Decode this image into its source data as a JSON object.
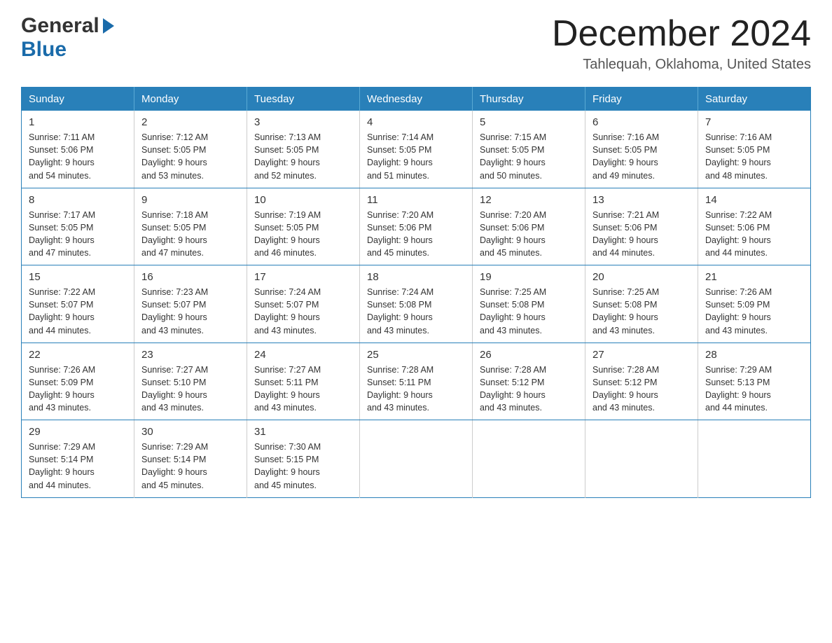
{
  "logo": {
    "general": "General",
    "blue": "Blue",
    "arrow": "▶"
  },
  "header": {
    "month_title": "December 2024",
    "location": "Tahlequah, Oklahoma, United States"
  },
  "weekdays": [
    "Sunday",
    "Monday",
    "Tuesday",
    "Wednesday",
    "Thursday",
    "Friday",
    "Saturday"
  ],
  "weeks": [
    [
      {
        "day": "1",
        "sunrise": "7:11 AM",
        "sunset": "5:06 PM",
        "daylight": "9 hours and 54 minutes."
      },
      {
        "day": "2",
        "sunrise": "7:12 AM",
        "sunset": "5:05 PM",
        "daylight": "9 hours and 53 minutes."
      },
      {
        "day": "3",
        "sunrise": "7:13 AM",
        "sunset": "5:05 PM",
        "daylight": "9 hours and 52 minutes."
      },
      {
        "day": "4",
        "sunrise": "7:14 AM",
        "sunset": "5:05 PM",
        "daylight": "9 hours and 51 minutes."
      },
      {
        "day": "5",
        "sunrise": "7:15 AM",
        "sunset": "5:05 PM",
        "daylight": "9 hours and 50 minutes."
      },
      {
        "day": "6",
        "sunrise": "7:16 AM",
        "sunset": "5:05 PM",
        "daylight": "9 hours and 49 minutes."
      },
      {
        "day": "7",
        "sunrise": "7:16 AM",
        "sunset": "5:05 PM",
        "daylight": "9 hours and 48 minutes."
      }
    ],
    [
      {
        "day": "8",
        "sunrise": "7:17 AM",
        "sunset": "5:05 PM",
        "daylight": "9 hours and 47 minutes."
      },
      {
        "day": "9",
        "sunrise": "7:18 AM",
        "sunset": "5:05 PM",
        "daylight": "9 hours and 47 minutes."
      },
      {
        "day": "10",
        "sunrise": "7:19 AM",
        "sunset": "5:05 PM",
        "daylight": "9 hours and 46 minutes."
      },
      {
        "day": "11",
        "sunrise": "7:20 AM",
        "sunset": "5:06 PM",
        "daylight": "9 hours and 45 minutes."
      },
      {
        "day": "12",
        "sunrise": "7:20 AM",
        "sunset": "5:06 PM",
        "daylight": "9 hours and 45 minutes."
      },
      {
        "day": "13",
        "sunrise": "7:21 AM",
        "sunset": "5:06 PM",
        "daylight": "9 hours and 44 minutes."
      },
      {
        "day": "14",
        "sunrise": "7:22 AM",
        "sunset": "5:06 PM",
        "daylight": "9 hours and 44 minutes."
      }
    ],
    [
      {
        "day": "15",
        "sunrise": "7:22 AM",
        "sunset": "5:07 PM",
        "daylight": "9 hours and 44 minutes."
      },
      {
        "day": "16",
        "sunrise": "7:23 AM",
        "sunset": "5:07 PM",
        "daylight": "9 hours and 43 minutes."
      },
      {
        "day": "17",
        "sunrise": "7:24 AM",
        "sunset": "5:07 PM",
        "daylight": "9 hours and 43 minutes."
      },
      {
        "day": "18",
        "sunrise": "7:24 AM",
        "sunset": "5:08 PM",
        "daylight": "9 hours and 43 minutes."
      },
      {
        "day": "19",
        "sunrise": "7:25 AM",
        "sunset": "5:08 PM",
        "daylight": "9 hours and 43 minutes."
      },
      {
        "day": "20",
        "sunrise": "7:25 AM",
        "sunset": "5:08 PM",
        "daylight": "9 hours and 43 minutes."
      },
      {
        "day": "21",
        "sunrise": "7:26 AM",
        "sunset": "5:09 PM",
        "daylight": "9 hours and 43 minutes."
      }
    ],
    [
      {
        "day": "22",
        "sunrise": "7:26 AM",
        "sunset": "5:09 PM",
        "daylight": "9 hours and 43 minutes."
      },
      {
        "day": "23",
        "sunrise": "7:27 AM",
        "sunset": "5:10 PM",
        "daylight": "9 hours and 43 minutes."
      },
      {
        "day": "24",
        "sunrise": "7:27 AM",
        "sunset": "5:11 PM",
        "daylight": "9 hours and 43 minutes."
      },
      {
        "day": "25",
        "sunrise": "7:28 AM",
        "sunset": "5:11 PM",
        "daylight": "9 hours and 43 minutes."
      },
      {
        "day": "26",
        "sunrise": "7:28 AM",
        "sunset": "5:12 PM",
        "daylight": "9 hours and 43 minutes."
      },
      {
        "day": "27",
        "sunrise": "7:28 AM",
        "sunset": "5:12 PM",
        "daylight": "9 hours and 43 minutes."
      },
      {
        "day": "28",
        "sunrise": "7:29 AM",
        "sunset": "5:13 PM",
        "daylight": "9 hours and 44 minutes."
      }
    ],
    [
      {
        "day": "29",
        "sunrise": "7:29 AM",
        "sunset": "5:14 PM",
        "daylight": "9 hours and 44 minutes."
      },
      {
        "day": "30",
        "sunrise": "7:29 AM",
        "sunset": "5:14 PM",
        "daylight": "9 hours and 45 minutes."
      },
      {
        "day": "31",
        "sunrise": "7:30 AM",
        "sunset": "5:15 PM",
        "daylight": "9 hours and 45 minutes."
      },
      null,
      null,
      null,
      null
    ]
  ]
}
